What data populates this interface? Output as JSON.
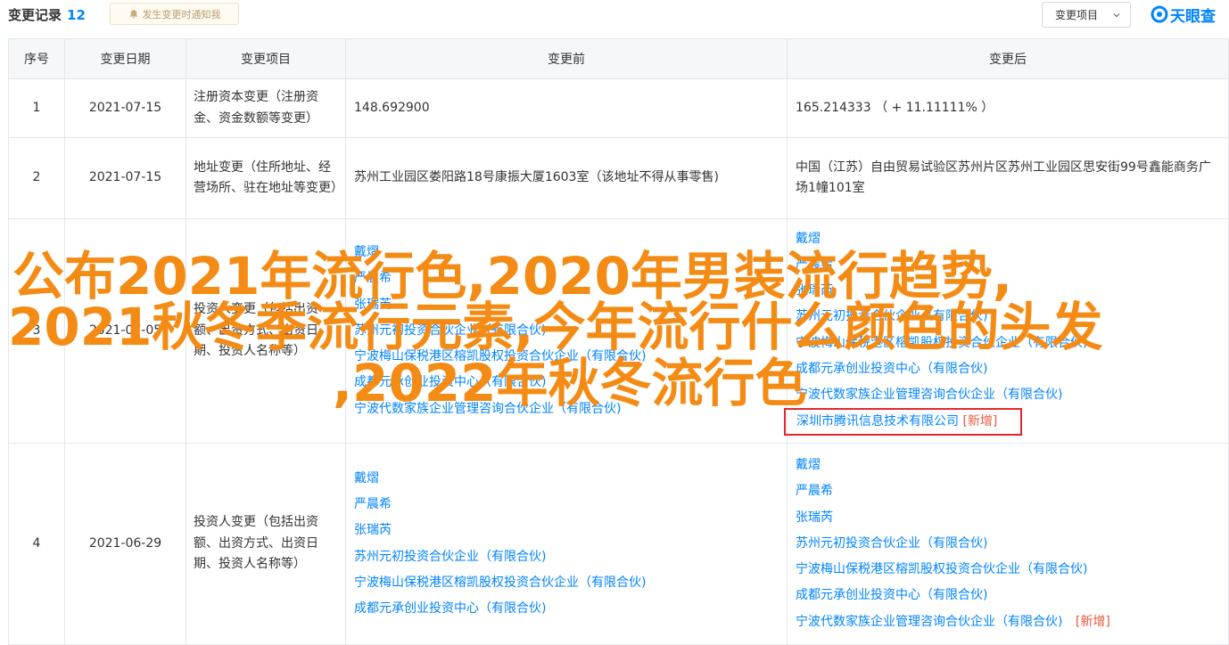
{
  "header": {
    "title": "变更记录",
    "count": "12",
    "notice": "发生变更时通知我",
    "filter_label": "变更项目",
    "logo_text": "天眼查"
  },
  "table": {
    "columns": [
      "序号",
      "变更日期",
      "变更项目",
      "变更前",
      "变更后"
    ],
    "rows": [
      {
        "index": "1",
        "date": "2021-07-15",
        "item": "注册资本变更（注册资金、资金数额等变更）",
        "before": "148.692900",
        "after": "165.214333 （ + 11.11111% ）"
      },
      {
        "index": "2",
        "date": "2021-07-15",
        "item": "地址变更（住所地址、经营场所、驻在地址等变更）",
        "before": "苏州工业园区娄阳路18号康振大厦1603室（该地址不得从事零售)",
        "after": "中国（江苏）自由贸易试验区苏州片区苏州工业园区思安街99号鑫能商务广场1幢101室"
      },
      {
        "index": "3",
        "date": "2021-07-05",
        "item": "投资人变更（包括出资额、出资方式、出资日期、投资人名称等）",
        "before": [
          "戴熠",
          "严晨希",
          "张瑞芮",
          "苏州元初投资合伙企业（有限合伙)",
          "宁波梅山保税港区榕凯股权投资合伙企业（有限合伙)",
          "成都元承创业投资中心（有限合伙)",
          "宁波代数家族企业管理咨询合伙企业（有限合伙)"
        ],
        "after": [
          "戴熠",
          "严晨希",
          "张瑞芮",
          "苏州元初投资合伙企业（有限合伙)",
          "宁波梅山保税港区榕凯股权投资合伙企业（有限合伙)",
          "成都元承创业投资中心（有限合伙)",
          "宁波代数家族企业管理咨询合伙企业（有限合伙)"
        ],
        "after_new": "深圳市腾讯信息技术有限公司",
        "new_tag": "[新增]"
      },
      {
        "index": "4",
        "date": "2021-06-29",
        "item": "投资人变更（包括出资额、出资方式、出资日期、投资人名称等）",
        "before": [
          "戴熠",
          "严晨希",
          "张瑞芮",
          "苏州元初投资合伙企业（有限合伙)",
          "宁波梅山保税港区榕凯股权投资合伙企业（有限合伙)",
          "成都元承创业投资中心（有限合伙)"
        ],
        "after": [
          "戴熠",
          "严晨希",
          "张瑞芮",
          "苏州元初投资合伙企业（有限合伙)",
          "宁波梅山保税港区榕凯股权投资合伙企业（有限合伙)",
          "成都元承创业投资中心（有限合伙)"
        ],
        "after_new": "宁波代数家族企业管理咨询合伙企业（有限合伙)",
        "new_tag": "[新增]"
      }
    ]
  },
  "overlay": {
    "line1": "公布2021年流行色,2020年男装流行趋势,",
    "line2": "2021秋冬季流行元素,今年流行什么颜色的头发",
    "line3": ",2022年秋冬流行色"
  },
  "colors": {
    "accent": "#0084ff",
    "changed_red": "#e9573f",
    "highlight_box": "#e6262b",
    "overlay_orange": "#f48b14"
  }
}
